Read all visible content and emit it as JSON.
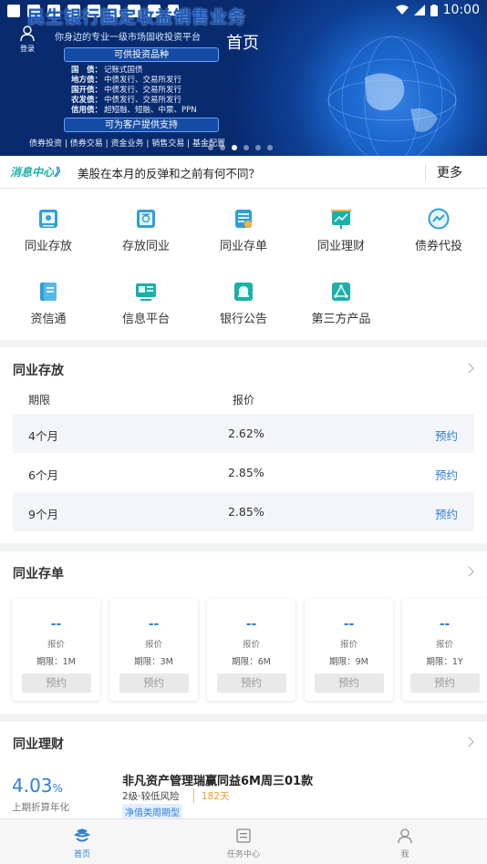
{
  "status_bar": {
    "time": "10:00"
  },
  "banner": {
    "headline": "民生银行固定收益销售业务",
    "subline": "你身边的专业一级市场固收投资平台",
    "pill_products": "可供投资品种",
    "bonds": [
      {
        "k": "国　债：",
        "v": "记账式国债"
      },
      {
        "k": "地方债：",
        "v": "中债发行、交易所发行"
      },
      {
        "k": "国开债：",
        "v": "中债发行、交易所发行"
      },
      {
        "k": "农发债：",
        "v": "中债发行、交易所发行"
      },
      {
        "k": "信用债：",
        "v": "超短融、短融、中票、PPN"
      }
    ],
    "pill_support": "可为客户提供支持",
    "services": "债券投资 | 债券交易 | 资金业务 | 销售交易 | 基金配置",
    "login_label": "登录",
    "page_title": "首页"
  },
  "news": {
    "tag_a": "消息中心",
    "tag_b": "》",
    "headline": "美股在本月的反弹和之前有何不同？",
    "more": "更多"
  },
  "menu": [
    {
      "label": "同业存放"
    },
    {
      "label": "存放同业"
    },
    {
      "label": "同业存单"
    },
    {
      "label": "同业理财"
    },
    {
      "label": "债券代投"
    },
    {
      "label": "资信通"
    },
    {
      "label": "信息平台"
    },
    {
      "label": "银行公告"
    },
    {
      "label": "第三方产品"
    }
  ],
  "deposit": {
    "title": "同业存放",
    "col_term": "期限",
    "col_price": "报价",
    "rows": [
      {
        "term": "4个月",
        "rate": "2.62%",
        "action": "预约"
      },
      {
        "term": "6个月",
        "rate": "2.85%",
        "action": "预约"
      },
      {
        "term": "9个月",
        "rate": "2.85%",
        "action": "预约"
      }
    ]
  },
  "cd": {
    "title": "同业存单",
    "items": [
      {
        "price": "--",
        "label": "报价",
        "term": "期限：1M",
        "btn": "预约"
      },
      {
        "price": "--",
        "label": "报价",
        "term": "期限：3M",
        "btn": "预约"
      },
      {
        "price": "--",
        "label": "报价",
        "term": "期限：6M",
        "btn": "预约"
      },
      {
        "price": "--",
        "label": "报价",
        "term": "期限：9M",
        "btn": "预约"
      },
      {
        "price": "--",
        "label": "报价",
        "term": "期限：1Y",
        "btn": "预约"
      }
    ]
  },
  "wm": {
    "title": "同业理财",
    "rate": "4.03",
    "rate_unit": "%",
    "rate_label": "上期折算年化",
    "name": "非凡资产管理瑞赢同益6M周三01款",
    "risk": "2级·较低风险",
    "days": "182天",
    "type": "净值类周期型"
  },
  "tabs": [
    {
      "label": "首页"
    },
    {
      "label": "任务中心"
    },
    {
      "label": "我"
    }
  ],
  "colors": {
    "accent": "#2f7fd8",
    "teal": "#19b0a8",
    "orange": "#f29a2e"
  }
}
